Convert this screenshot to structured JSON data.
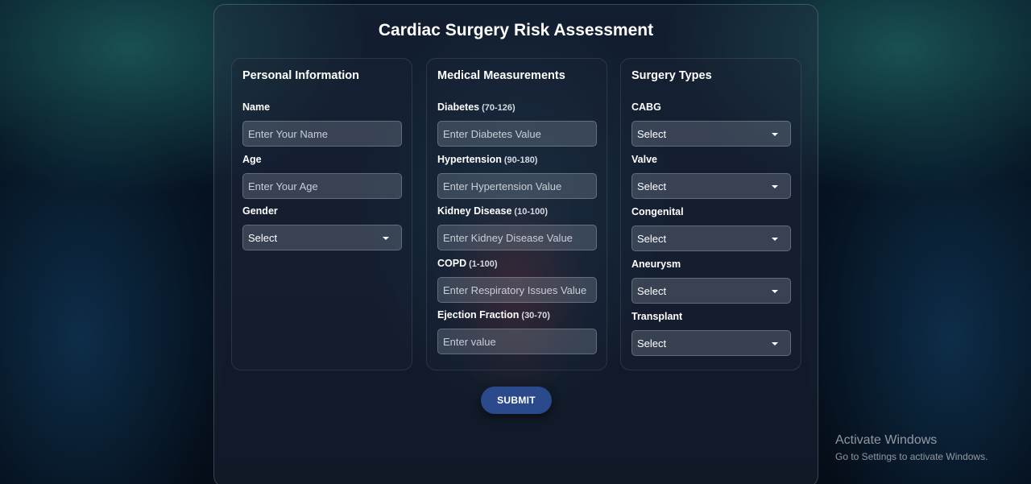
{
  "page": {
    "title": "Cardiac Surgery Risk Assessment",
    "submit_label": "SUBMIT"
  },
  "personal": {
    "title": "Personal Information",
    "name_label": "Name",
    "name_placeholder": "Enter Your Name",
    "age_label": "Age",
    "age_placeholder": "Enter Your Age",
    "gender_label": "Gender",
    "gender_value": "Select"
  },
  "medical": {
    "title": "Medical Measurements",
    "fields": [
      {
        "label": "Diabetes",
        "range": "(70-126)",
        "placeholder": "Enter Diabetes Value"
      },
      {
        "label": "Hypertension",
        "range": "(90-180)",
        "placeholder": "Enter Hypertension Value"
      },
      {
        "label": "Kidney Disease",
        "range": "(10-100)",
        "placeholder": "Enter Kidney Disease Value"
      },
      {
        "label": "COPD",
        "range": "(1-100)",
        "placeholder": "Enter Respiratory Issues Value"
      },
      {
        "label": "Ejection Fraction",
        "range": "(30-70)",
        "placeholder": "Enter value"
      }
    ]
  },
  "surgery": {
    "title": "Surgery Types",
    "fields": [
      {
        "label": "CABG",
        "value": "Select"
      },
      {
        "label": "Valve",
        "value": "Select"
      },
      {
        "label": "Congenital",
        "value": "Select"
      },
      {
        "label": "Aneurysm",
        "value": "Select"
      },
      {
        "label": "Transplant",
        "value": "Select"
      }
    ]
  },
  "watermark": {
    "title": "Activate Windows",
    "subtitle": "Go to Settings to activate Windows."
  }
}
